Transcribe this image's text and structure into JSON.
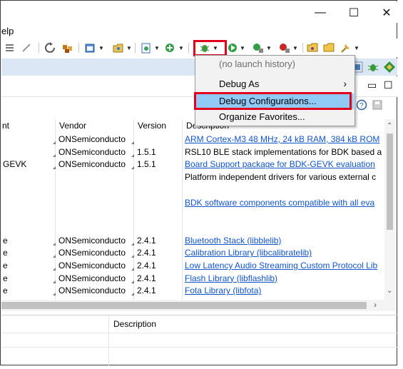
{
  "window": {
    "minimize_glyph": "—",
    "maximize_glyph": "☐",
    "close_glyph": "✕"
  },
  "menubar": {
    "help_partial": "elp"
  },
  "toolbar_icons": [
    "format-icon",
    "wand-icon",
    "refresh-icon",
    "package-icon",
    "new-project-icon",
    "open-type-icon",
    "new-class-icon",
    "run-config-icon",
    "debug-icon",
    "run-icon",
    "external-tools-icon",
    "stop-icon",
    "folder-open-icon",
    "folder-icon",
    "pin-icon"
  ],
  "dropdown": {
    "items": [
      {
        "label": "(no launch history)",
        "disabled": true
      },
      {
        "label": "Debug As",
        "submenu": true,
        "arrow": "›"
      },
      {
        "label": "Debug Configurations...",
        "highlighted": true
      },
      {
        "label": "Organize Favorites..."
      }
    ]
  },
  "table": {
    "headers": [
      "nt",
      "Vendor",
      "Version",
      "Description"
    ],
    "rows": [
      {
        "name": "",
        "vendor": "ONSemiconducto",
        "version": "",
        "description": "ARM Cortex-M3 48 MHz, 24 kB RAM, 384 kB ROM",
        "link": true
      },
      {
        "name": "",
        "vendor": "ONSemiconducto",
        "version": "1.5.1",
        "description": "RSL10 BLE stack implementations for BDK based a",
        "link": false
      },
      {
        "name": "GEVK",
        "vendor": "ONSemiconducto",
        "version": "1.5.1",
        "description": "Board Support package for BDK-GEVK evaluation",
        "link": true
      },
      {
        "name": "",
        "vendor": "",
        "version": "",
        "description": "Platform independent drivers for various external c",
        "link": false
      },
      {
        "name": "",
        "vendor": "",
        "version": "",
        "description": "",
        "link": false
      },
      {
        "name": "",
        "vendor": "",
        "version": "",
        "description": "BDK software components compatible with all eva",
        "link": true
      },
      {
        "name": "",
        "vendor": "",
        "version": "",
        "description": "",
        "link": false
      },
      {
        "name": "",
        "vendor": "",
        "version": "",
        "description": "",
        "link": false
      },
      {
        "name": "e",
        "vendor": "ONSemiconducto",
        "version": "2.4.1",
        "description": "Bluetooth Stack (libblelib)",
        "link": true
      },
      {
        "name": "e",
        "vendor": "ONSemiconducto",
        "version": "2.4.1",
        "description": "Calibration Library (libcalibratelib)",
        "link": true
      },
      {
        "name": "e",
        "vendor": "ONSemiconducto",
        "version": "2.4.1",
        "description": "Low Latency Audio Streaming Custom Protocol Lib",
        "link": true
      },
      {
        "name": "e",
        "vendor": "ONSemiconducto",
        "version": "2.4.1",
        "description": "Flash Library (libflashlib)",
        "link": true
      },
      {
        "name": "e",
        "vendor": "ONSemiconducto",
        "version": "2.4.1",
        "description": "Fota Library (libfota)",
        "link": true
      }
    ]
  },
  "bottom_panel": {
    "description_header": "Description"
  },
  "colors": {
    "highlight": "#91c9f7",
    "callout": "#e0001b",
    "link": "#1155cc"
  }
}
